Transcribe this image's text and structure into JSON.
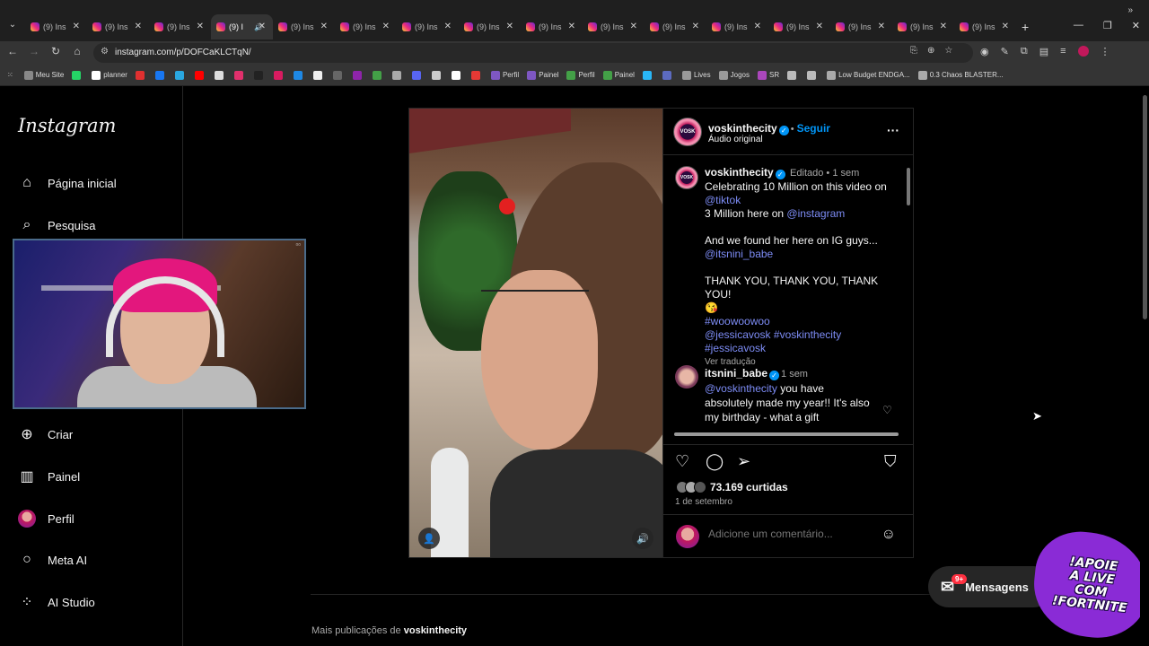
{
  "browser": {
    "tabs": [
      {
        "title": "(9) Ins",
        "active": false
      },
      {
        "title": "(9) Ins",
        "active": false
      },
      {
        "title": "(9) Ins",
        "active": false
      },
      {
        "title": "(9) I",
        "active": true,
        "audio": "🔊"
      },
      {
        "title": "(9) Ins",
        "active": false
      },
      {
        "title": "(9) Ins",
        "active": false
      },
      {
        "title": "(9) Ins",
        "active": false
      },
      {
        "title": "(9) Ins",
        "active": false
      },
      {
        "title": "(9) Ins",
        "active": false
      },
      {
        "title": "(9) Ins",
        "active": false
      },
      {
        "title": "(9) Ins",
        "active": false
      },
      {
        "title": "(9) Ins",
        "active": false
      },
      {
        "title": "(9) Ins",
        "active": false
      },
      {
        "title": "(9) Ins",
        "active": false
      },
      {
        "title": "(9) Ins",
        "active": false
      },
      {
        "title": "(9) Ins",
        "active": false
      }
    ],
    "url": "instagram.com/p/DOFCaKLCTqN/",
    "bookmarks": [
      {
        "label": "Meu Site",
        "color": "#888888"
      },
      {
        "label": "",
        "color": "#25d366"
      },
      {
        "label": "planner",
        "color": "#ffffff"
      },
      {
        "label": "",
        "color": "#e03030"
      },
      {
        "label": "",
        "color": "#1877f2"
      },
      {
        "label": "",
        "color": "#2aa7e0"
      },
      {
        "label": "",
        "color": "#ff0000"
      },
      {
        "label": "",
        "color": "#dddddd"
      },
      {
        "label": "",
        "color": "#e1306c"
      },
      {
        "label": "",
        "color": "#222222"
      },
      {
        "label": "",
        "color": "#d81b60"
      },
      {
        "label": "",
        "color": "#1e88e5"
      },
      {
        "label": "",
        "color": "#eeeeee"
      },
      {
        "label": "",
        "color": "#666666"
      },
      {
        "label": "",
        "color": "#8e24aa"
      },
      {
        "label": "",
        "color": "#43a047"
      },
      {
        "label": "",
        "color": "#aaaaaa"
      },
      {
        "label": "",
        "color": "#5865f2"
      },
      {
        "label": "",
        "color": "#cccccc"
      },
      {
        "label": "",
        "color": "#ffffff"
      },
      {
        "label": "",
        "color": "#e53935"
      },
      {
        "label": "Perfil",
        "color": "#7e57c2"
      },
      {
        "label": "Painel",
        "color": "#7e57c2"
      },
      {
        "label": "Perfil",
        "color": "#43a047"
      },
      {
        "label": "Painel",
        "color": "#43a047"
      },
      {
        "label": "",
        "color": "#29b6f6"
      },
      {
        "label": "",
        "color": "#5c6bc0"
      },
      {
        "label": "Lives",
        "color": "#999999"
      },
      {
        "label": "Jogos",
        "color": "#999999"
      },
      {
        "label": "SR",
        "color": "#ab47bc"
      },
      {
        "label": "",
        "color": "#bbbbbb"
      },
      {
        "label": "",
        "color": "#bbbbbb"
      },
      {
        "label": "Low Budget ENDGA...",
        "color": "#aaaaaa"
      },
      {
        "label": "0.3 Chaos BLASTER...",
        "color": "#aaaaaa"
      }
    ]
  },
  "sidebar": {
    "logo": "Instagram",
    "items": [
      {
        "label": "Página inicial",
        "icon": "home-icon",
        "glyph": "⌂"
      },
      {
        "label": "Pesquisa",
        "icon": "search-icon",
        "glyph": "⌕"
      },
      {
        "label": "Criar",
        "icon": "create-icon",
        "glyph": "⊕"
      },
      {
        "label": "Painel",
        "icon": "dashboard-icon",
        "glyph": "▥"
      },
      {
        "label": "Perfil",
        "icon": "profile-avatar",
        "glyph": ""
      },
      {
        "label": "Meta AI",
        "icon": "meta-ai-icon",
        "glyph": "○"
      },
      {
        "label": "AI Studio",
        "icon": "ai-studio-icon",
        "glyph": "⁘"
      }
    ]
  },
  "post": {
    "header": {
      "username": "voskinthecity",
      "follow": "Seguir",
      "audio": "Áudio original",
      "avatar_text": "VOSK"
    },
    "caption": {
      "username": "voskinthecity",
      "edited": "Editado",
      "time": "1 sem",
      "line1": "Celebrating 10 Million on this video on",
      "mention1": "@tiktok",
      "line2_pre": "3 Million here on ",
      "mention2": "@instagram",
      "line3": "And we found her here on IG guys...",
      "mention3": "@itsnini_babe",
      "line4": "THANK YOU, THANK YOU, THANK YOU!",
      "emoji": "😘",
      "tag1": "#woowoowoo",
      "tag2": "@jessicavosk",
      "tag3": "#voskinthecity",
      "tag4": "#jessicavosk",
      "translate": "Ver tradução"
    },
    "comment": {
      "username": "itsnini_babe",
      "time": "1 sem",
      "mention": "@voskinthecity",
      "text": " you have absolutely made my year!! It's also my birthday - what a gift"
    },
    "likes": "73.169 curtidas",
    "date": "1 de setembro",
    "add_comment_placeholder": "Adicione um comentário..."
  },
  "bottom": {
    "more_prefix": "Mais publicações de ",
    "more_user": "voskinthecity",
    "messages": "Mensagens",
    "messages_badge": "9+"
  },
  "overlay": {
    "promo_text": "!APOIE\nA LIVE\nCOM\n!FORTNITE"
  }
}
